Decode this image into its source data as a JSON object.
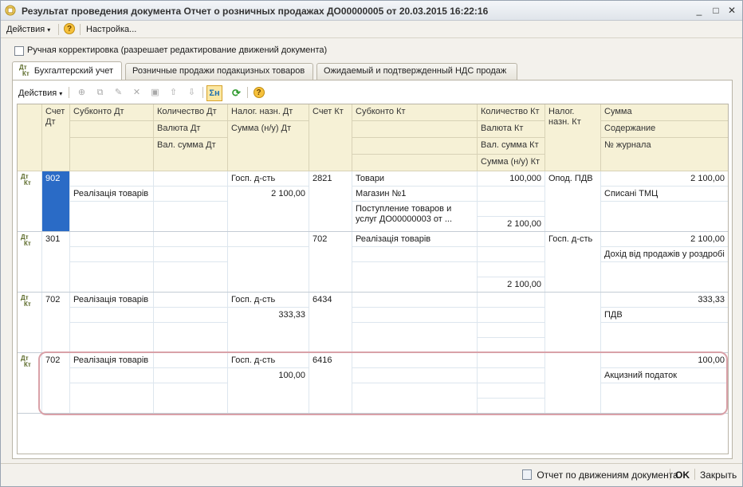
{
  "window": {
    "title": "Результат проведения документа Отчет о розничных продажах ДО00000005 от 20.03.2015 16:22:16",
    "controls": [
      "_",
      "□",
      "✕"
    ]
  },
  "menubar": {
    "actions_label": "Действия",
    "actions_arrow": "▾",
    "help_label": "?",
    "settings_label": "Настройка..."
  },
  "manual_correction": {
    "label": "Ручная корректировка (разрешает редактирование движений документа)",
    "checked": false
  },
  "tabs": [
    {
      "icon_top": "Дт",
      "icon_bottom": "Кт",
      "label": "Бухгалтерский учет",
      "active": true
    },
    {
      "label": "Розничные продажи подакцизных товаров",
      "active": false
    },
    {
      "label": "Ожидаемый и подтвержденный НДС продаж",
      "active": false
    }
  ],
  "toolbar": {
    "actions_label": "Действия",
    "actions_arrow": "▾",
    "sum_label": "Σн",
    "refresh_label": "⟳",
    "help_label": "?"
  },
  "grid": {
    "headers": {
      "account_dt": "Счет Дт",
      "subconto_dt": "Субконто Дт",
      "qty_dt": "Количество Дт",
      "currency_dt": "Валюта Дт",
      "cur_sum_dt": "Вал. сумма Дт",
      "tax_purpose_dt": "Налог. назн. Дт",
      "sum_nu_dt": "Сумма (н/у) Дт",
      "account_kt": "Счет Кт",
      "subconto_kt": "Субконто Кт",
      "qty_kt": "Количество Кт",
      "currency_kt": "Валюта Кт",
      "cur_sum_kt": "Вал. сумма Кт",
      "sum_nu_kt": "Сумма (н/у) Кт",
      "tax_purpose_kt": "Налог. назн. Кт",
      "sum": "Сумма",
      "content": "Содержание",
      "journal": "№ журнала"
    },
    "rows": [
      {
        "icon_top": "Дт",
        "icon_bottom": "Кт",
        "account_dt": "902",
        "subconto_dt": [
          "",
          "Реалізація товарів",
          ""
        ],
        "qty_dt": "",
        "tax_purpose_dt": "Госп. д-сть",
        "sum_nu_dt": "2 100,00",
        "account_kt": "2821",
        "subconto_kt": [
          "Товари",
          "Магазин №1",
          "Поступление товаров и услуг ДО00000003 от ..."
        ],
        "qty_kt": "100,000",
        "sum_nu_kt": "2 100,00",
        "tax_purpose_kt": "Опод. ПДВ",
        "sum": "2 100,00",
        "content": "Списані ТМЦ",
        "selected": true
      },
      {
        "icon_top": "Дт",
        "icon_bottom": "Кт",
        "account_dt": "301",
        "subconto_dt": [
          "",
          "",
          ""
        ],
        "qty_dt": "",
        "tax_purpose_dt": "",
        "sum_nu_dt": "",
        "account_kt": "702",
        "subconto_kt": [
          "Реалізація товарів",
          "",
          ""
        ],
        "qty_kt": "",
        "sum_nu_kt": "2 100,00",
        "tax_purpose_kt": "Госп. д-сть",
        "sum": "2 100,00",
        "content": "Дохід від продажів у роздробі"
      },
      {
        "icon_top": "Дт",
        "icon_bottom": "Кт",
        "account_dt": "702",
        "subconto_dt": [
          "Реалізація товарів",
          "",
          ""
        ],
        "qty_dt": "",
        "tax_purpose_dt": "Госп. д-сть",
        "sum_nu_dt": "333,33",
        "account_kt": "6434",
        "subconto_kt": [
          "",
          "",
          ""
        ],
        "qty_kt": "",
        "sum_nu_kt": "",
        "tax_purpose_kt": "",
        "sum": "333,33",
        "content": "ПДВ"
      },
      {
        "icon_top": "Дт",
        "icon_bottom": "Кт",
        "account_dt": "702",
        "subconto_dt": [
          "Реалізація товарів",
          "",
          ""
        ],
        "qty_dt": "",
        "tax_purpose_dt": "Госп. д-сть",
        "sum_nu_dt": "100,00",
        "account_kt": "6416",
        "subconto_kt": [
          "",
          "",
          ""
        ],
        "qty_kt": "",
        "sum_nu_kt": "",
        "tax_purpose_kt": "",
        "sum": "100,00",
        "content": "Акцизний податок"
      }
    ]
  },
  "statusbar": {
    "report_label": "Отчет по движениям документа",
    "ok_label": "OK",
    "close_label": "Закрыть"
  },
  "colors": {
    "header_bg": "#f6f1d6",
    "selection": "#2a6bc6",
    "highlight_border": "#d9a1a8"
  }
}
